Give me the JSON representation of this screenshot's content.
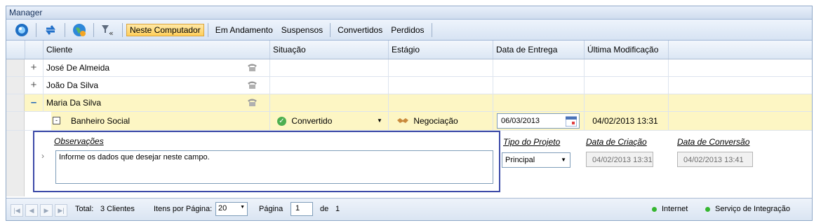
{
  "window": {
    "title": "Manager"
  },
  "toolbar": {
    "icons": [
      "logo-icon",
      "refresh-icon",
      "globe-icon",
      "filter-clear-icon"
    ],
    "filters": [
      "Neste Computador",
      "Em Andamento",
      "Suspensos",
      "Convertidos",
      "Perdidos"
    ],
    "active_filter": "Neste Computador"
  },
  "grid": {
    "columns": [
      "Cliente",
      "Situação",
      "Estágio",
      "Data de Entrega",
      "Última Modificação"
    ],
    "rows": [
      {
        "client": "José De Almeida",
        "expander": "+"
      },
      {
        "client": "João Da Silva",
        "expander": "+"
      },
      {
        "client": "Maria Da Silva",
        "expander": "–"
      }
    ],
    "project": {
      "name": "Banheiro Social",
      "status": "Convertido",
      "stage": "Negociação",
      "delivery_date": "06/03/2013",
      "last_modified": "04/02/2013 13:31"
    },
    "detail": {
      "obs_label": "Observações",
      "obs_value": "Informe os dados que desejar neste campo.",
      "type_label": "Tipo do Projeto",
      "type_value": "Principal",
      "created_label": "Data de Criação",
      "created_value": "04/02/2013 13:31",
      "converted_label": "Data de Conversão",
      "converted_value": "04/02/2013 13:41"
    }
  },
  "footer": {
    "total_label": "Total:",
    "total_value": "3 Clientes",
    "per_page_label": "Itens por Página:",
    "per_page_value": "20",
    "page_label": "Página",
    "page_value": "1",
    "of_label": "de",
    "page_count": "1",
    "status_internet": "Internet",
    "status_integration": "Serviço de Integração"
  },
  "colors": {
    "highlight_row": "#fdf6c4",
    "active_filter": "#ffcf5a",
    "detail_border": "#3c4aa8",
    "status_ok": "#35b62f"
  }
}
